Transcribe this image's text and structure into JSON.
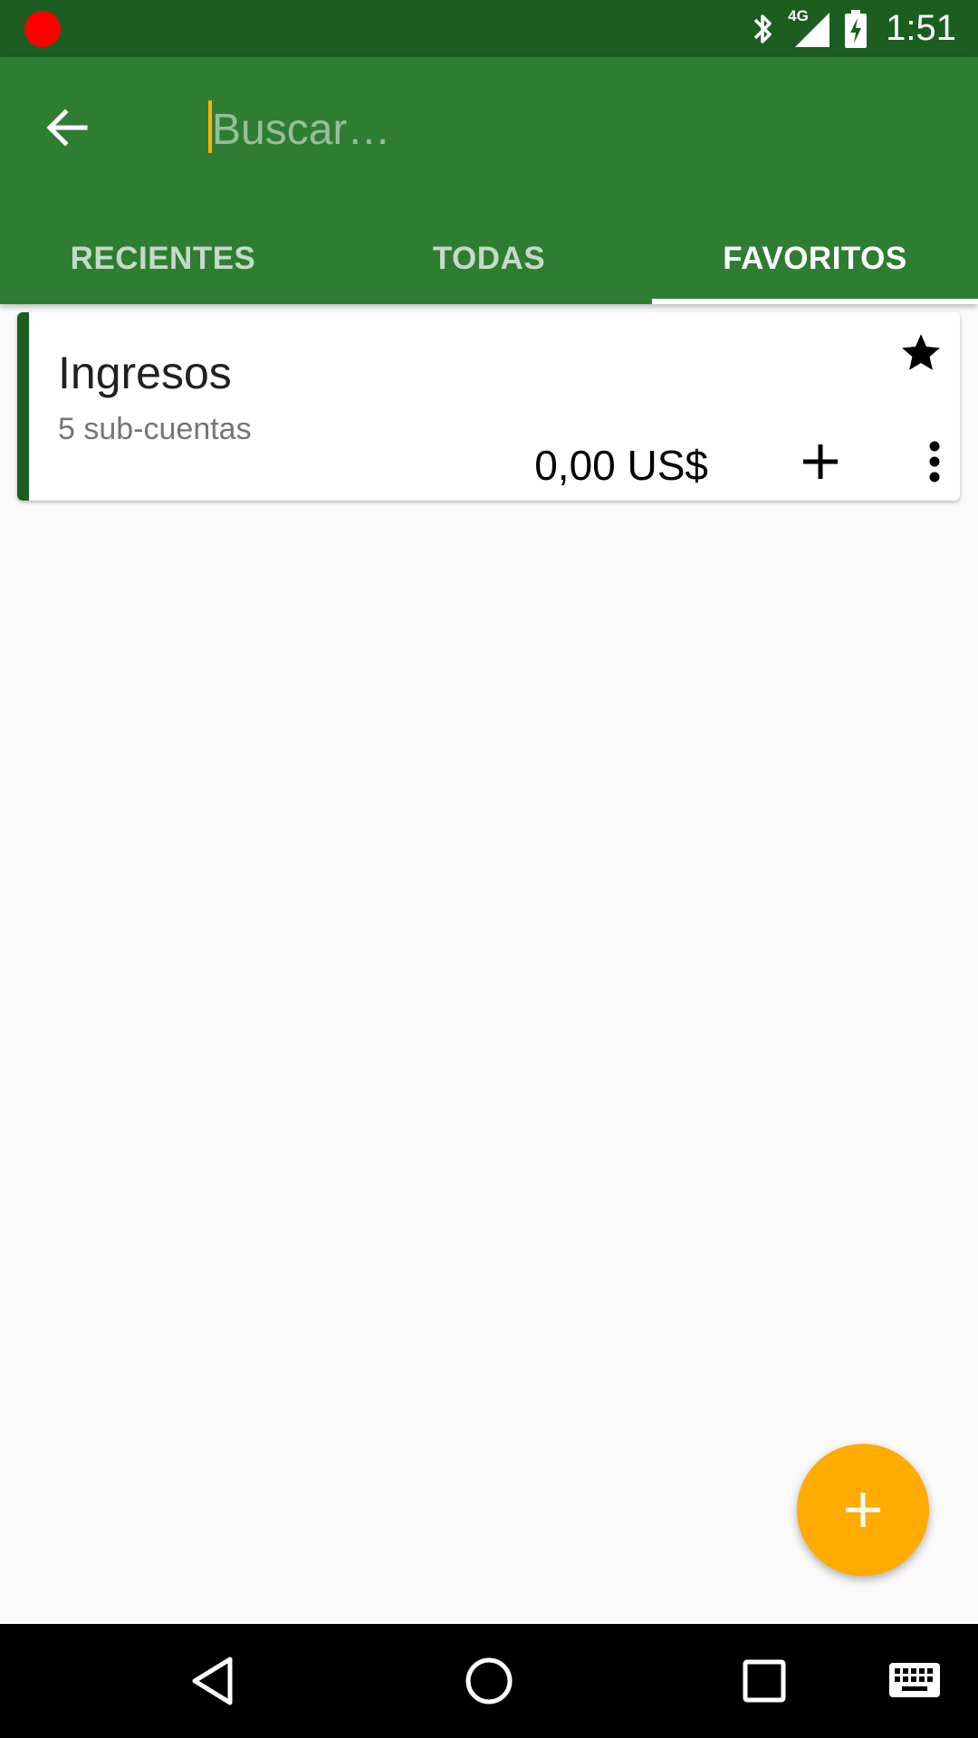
{
  "status_bar": {
    "time": "1:51",
    "network_label": "4G",
    "recording_color": "#ff0000",
    "icons": [
      "bluetooth-icon",
      "signal-4g-icon",
      "battery-charging-icon"
    ]
  },
  "app_bar": {
    "background": "#2e7d32",
    "search": {
      "placeholder": "Buscar…",
      "value": ""
    },
    "tabs": [
      {
        "label": "RECIENTES",
        "active": false
      },
      {
        "label": "TODAS",
        "active": false
      },
      {
        "label": "FAVORITOS",
        "active": true
      }
    ]
  },
  "accounts": [
    {
      "name": "Ingresos",
      "subaccounts": "5 sub-cuentas",
      "balance": "0,00 US$",
      "favorite": true,
      "color": "#1b5e20"
    }
  ],
  "fab": {
    "icon": "plus-icon",
    "color": "#ffab00"
  },
  "nav_bar": {
    "icons": [
      "back-triangle-icon",
      "home-circle-icon",
      "recents-square-icon",
      "keyboard-icon"
    ]
  }
}
